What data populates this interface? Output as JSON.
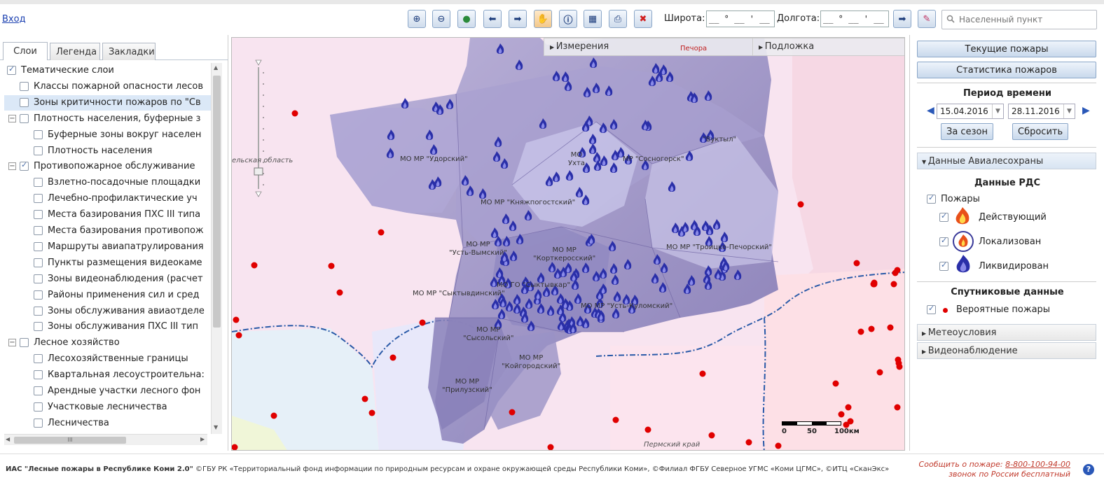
{
  "topbar": {
    "login": "Вход",
    "lat_label": "Широта:",
    "lon_label": "Долгота:",
    "lat_value": "__ ° __ ' __ \"",
    "lon_value": "__ ° __ ' __ \"",
    "search_placeholder": "Населенный пункт",
    "tools": [
      "zoom-in-icon",
      "zoom-out-icon",
      "globe-icon",
      "arrow-left-icon",
      "arrow-right-icon",
      "hand-icon",
      "info-icon",
      "measure-icon",
      "print-icon",
      "close-icon"
    ]
  },
  "left": {
    "tabs": [
      {
        "label": "Слои"
      },
      {
        "label": "Легенда"
      },
      {
        "label": "Закладки"
      }
    ],
    "tree": [
      {
        "label": "Тематические слои",
        "level": 0,
        "expander": "−",
        "checked": true
      },
      {
        "label": "Классы пожарной опасности лесов",
        "level": 1,
        "checked": false
      },
      {
        "label": "Зоны критичности пожаров по \"Св",
        "level": 1,
        "checked": false,
        "selected": true
      },
      {
        "label": "Плотность населения, буферные з",
        "level": 1,
        "expander": "−",
        "checked": false
      },
      {
        "label": "Буферные зоны вокруг населен",
        "level": 2,
        "checked": false
      },
      {
        "label": "Плотность населения",
        "level": 2,
        "checked": false
      },
      {
        "label": "Противопожарное обслуживание",
        "level": 1,
        "expander": "−",
        "checked": true
      },
      {
        "label": "Взлетно-посадочные площадки",
        "level": 2,
        "checked": false
      },
      {
        "label": "Лечебно-профилактические уч",
        "level": 2,
        "checked": false
      },
      {
        "label": "Места базирования ПХС III типа",
        "level": 2,
        "checked": false
      },
      {
        "label": "Места базирования противопож",
        "level": 2,
        "checked": false
      },
      {
        "label": "Маршруты авиапатрулирования",
        "level": 2,
        "checked": false
      },
      {
        "label": "Пункты размещения видеокаме",
        "level": 2,
        "checked": false
      },
      {
        "label": "Зоны видеонаблюдения (расчет",
        "level": 2,
        "checked": false
      },
      {
        "label": "Районы применения сил и сред",
        "level": 2,
        "checked": false
      },
      {
        "label": "Зоны обслуживания авиаотделе",
        "level": 2,
        "checked": false
      },
      {
        "label": "Зоны обслуживания ПХС III тип",
        "level": 2,
        "checked": false
      },
      {
        "label": "Лесное хозяйство",
        "level": 1,
        "expander": "−",
        "checked": false
      },
      {
        "label": "Лесохозяйственные границы",
        "level": 2,
        "checked": false
      },
      {
        "label": "Квартальная лесоустроительна:",
        "level": 2,
        "checked": false
      },
      {
        "label": "Арендные участки лесного фон",
        "level": 2,
        "checked": false
      },
      {
        "label": "Участковые лесничества",
        "level": 2,
        "checked": false
      },
      {
        "label": "Лесничества",
        "level": 2,
        "checked": false
      }
    ],
    "hscroll_thumb": "III"
  },
  "map": {
    "tab_measure": "Измерения",
    "tab_base": "Подложка",
    "district_labels": [
      {
        "text": "МО МР \"Удорский\""
      },
      {
        "text": "МО\nУхта"
      },
      {
        "text": "МР \"Сосногорск\""
      },
      {
        "text": "\"Вуктыл\""
      },
      {
        "text": "МО МР \"Княжпогостский\""
      },
      {
        "text": "МО МР\n\"Усть-Вымский\""
      },
      {
        "text": "МО МР\n\"Корткеросский\""
      },
      {
        "text": "МО МР \"Троицко-Печорский\""
      },
      {
        "text": "МО ГО \"Сыктывкар\""
      },
      {
        "text": "МО МР \"Сыктывдинский\""
      },
      {
        "text": "МО МР \"Усть-Куломский\""
      },
      {
        "text": "МО МР\n\"Сысольский\""
      },
      {
        "text": "МО МР\n\"Койгородский\""
      },
      {
        "text": "МО МР\n\"Прилузский\""
      },
      {
        "text": "Печора"
      }
    ],
    "region_labels": [
      {
        "text": "ельская область"
      },
      {
        "text": "Пермский край"
      }
    ],
    "scale": {
      "zero": "0",
      "mid": "50",
      "end": "100км"
    }
  },
  "right": {
    "btn_current": "Текущие пожары",
    "btn_stats": "Статистика пожаров",
    "period_title": "Период времени",
    "date_from": "15.04.2016",
    "date_to": "28.11.2016",
    "btn_season": "За сезон",
    "btn_reset": "Сбросить",
    "acc_avia": "Данные Авиалесохраны",
    "rds_title": "Данные РДС",
    "fires_label": "Пожары",
    "active_label": "Действующий",
    "localized_label": "Локализован",
    "extinguished_label": "Ликвидирован",
    "sat_title": "Спутниковые данные",
    "probable_label": "Вероятные пожары",
    "acc_meteo": "Метеоусловия",
    "acc_video": "Видеонаблюдение"
  },
  "footer": {
    "app_name": "ИАС \"Лесные пожары в Республике Коми 2.0\"",
    "credits": " ©ГБУ РК «Территориальный фонд информации по природным ресурсам и охране окружающей среды Республики Коми», ©Филиал ФГБУ Северное УГМС «Коми ЦГМС», ©ИТЦ «СканЭкс»",
    "report_text": "Сообщить о пожаре: ",
    "phone": "8-800-100-94-00",
    "free_call": "звонок по России бесплатный"
  },
  "colors": {
    "fire_blue": "#3a3fb8",
    "probable_red": "#e00000",
    "district_purple": "#9b93c4",
    "border_blue": "#2a5aa8"
  }
}
